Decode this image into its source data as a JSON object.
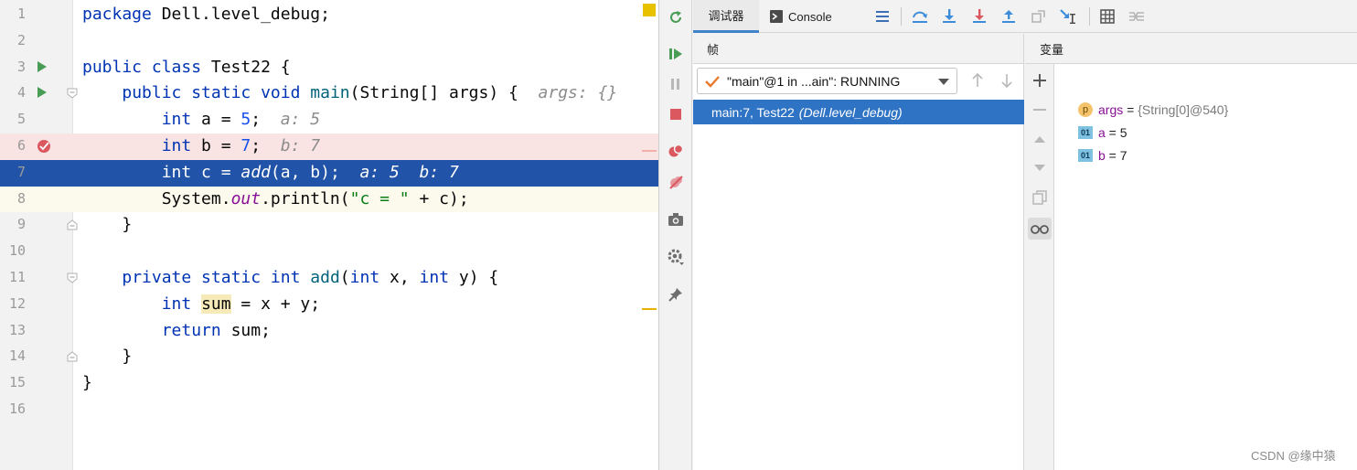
{
  "editor": {
    "lines": [
      {
        "n": "1",
        "tokens": [
          {
            "c": "kw",
            "t": "package"
          },
          {
            "c": "",
            "t": " Dell.level_debug;"
          }
        ]
      },
      {
        "n": "2",
        "tokens": []
      },
      {
        "n": "3",
        "tokens": [
          {
            "c": "kw",
            "t": "public class"
          },
          {
            "c": "",
            "t": " Test22 {"
          }
        ]
      },
      {
        "n": "4",
        "tokens": [
          {
            "c": "",
            "t": "    "
          },
          {
            "c": "kw",
            "t": "public static void"
          },
          {
            "c": "",
            "t": " "
          },
          {
            "c": "fn",
            "t": "main"
          },
          {
            "c": "",
            "t": "(String[] args) {  "
          },
          {
            "c": "hint",
            "t": "args: {}"
          }
        ]
      },
      {
        "n": "5",
        "tokens": [
          {
            "c": "",
            "t": "        "
          },
          {
            "c": "kw",
            "t": "int"
          },
          {
            "c": "",
            "t": " a = "
          },
          {
            "c": "num",
            "t": "5"
          },
          {
            "c": "",
            "t": ";  "
          },
          {
            "c": "hint",
            "t": "a: 5"
          }
        ]
      },
      {
        "n": "6",
        "tokens": [
          {
            "c": "",
            "t": "        "
          },
          {
            "c": "kw",
            "t": "int"
          },
          {
            "c": "",
            "t": " b = "
          },
          {
            "c": "num",
            "t": "7"
          },
          {
            "c": "",
            "t": ";  "
          },
          {
            "c": "hint",
            "t": "b: 7"
          }
        ]
      },
      {
        "n": "7",
        "tokens": [
          {
            "c": "",
            "t": "        "
          },
          {
            "c": "kw",
            "t": "int"
          },
          {
            "c": "",
            "t": " c = "
          },
          {
            "c": "ital",
            "t": "add"
          },
          {
            "c": "",
            "t": "(a, b);  "
          },
          {
            "c": "hint",
            "t": "a: 5  b: 7"
          }
        ]
      },
      {
        "n": "8",
        "tokens": [
          {
            "c": "",
            "t": "        System."
          },
          {
            "c": "static-field",
            "t": "out"
          },
          {
            "c": "",
            "t": ".println("
          },
          {
            "c": "str",
            "t": "\"c = \""
          },
          {
            "c": "",
            "t": " + c);"
          }
        ]
      },
      {
        "n": "9",
        "tokens": [
          {
            "c": "",
            "t": "    }"
          }
        ]
      },
      {
        "n": "10",
        "tokens": []
      },
      {
        "n": "11",
        "tokens": [
          {
            "c": "",
            "t": "    "
          },
          {
            "c": "kw",
            "t": "private static int"
          },
          {
            "c": "",
            "t": " "
          },
          {
            "c": "fn",
            "t": "add"
          },
          {
            "c": "",
            "t": "("
          },
          {
            "c": "kw",
            "t": "int"
          },
          {
            "c": "",
            "t": " x, "
          },
          {
            "c": "kw",
            "t": "int"
          },
          {
            "c": "",
            "t": " y) {"
          }
        ]
      },
      {
        "n": "12",
        "tokens": [
          {
            "c": "",
            "t": "        "
          },
          {
            "c": "kw",
            "t": "int"
          },
          {
            "c": "",
            "t": " "
          },
          {
            "c": "usage",
            "t": "sum"
          },
          {
            "c": "",
            "t": " = x + y;"
          }
        ]
      },
      {
        "n": "13",
        "tokens": [
          {
            "c": "",
            "t": "        "
          },
          {
            "c": "kw",
            "t": "return"
          },
          {
            "c": "",
            "t": " sum;"
          }
        ]
      },
      {
        "n": "14",
        "tokens": [
          {
            "c": "",
            "t": "    }"
          }
        ]
      },
      {
        "n": "15",
        "tokens": [
          {
            "c": "",
            "t": "}"
          }
        ]
      },
      {
        "n": "16",
        "tokens": []
      }
    ]
  },
  "debugger": {
    "tab_debugger": "调试器",
    "tab_console": "Console",
    "frames_title": "帧",
    "variables_title": "变量",
    "thread_selector": "\"main\"@1 in ...ain\": RUNNING",
    "frame_location": "main:7, Test22",
    "frame_package": "(Dell.level_debug)",
    "variables": [
      {
        "badge": "p",
        "name": "args",
        "eq": " = ",
        "value": "{String[0]@540}",
        "object": true
      },
      {
        "badge": "01",
        "name": "a",
        "eq": " = ",
        "value": "5",
        "object": false
      },
      {
        "badge": "01",
        "name": "b",
        "eq": " = ",
        "value": "7",
        "object": false
      }
    ]
  },
  "watermark": "CSDN @缘中猿",
  "colors": {
    "breakpoint_line": "#fae3e3",
    "execution_line": "#2154a8",
    "selected_frame": "#2f73c5",
    "keyword": "#0033b3"
  }
}
